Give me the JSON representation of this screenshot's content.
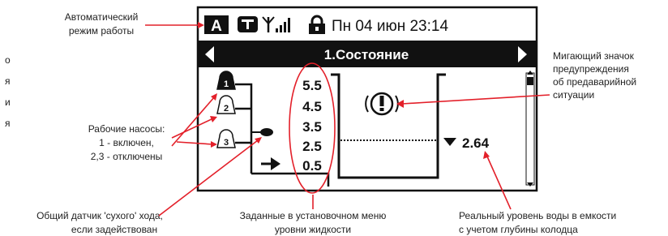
{
  "status_bar": {
    "mode_letter": "A",
    "date_time": "Пн 04 июн 23:14",
    "icons": [
      "pump-mode-icon",
      "antenna-signal-icon",
      "lock-icon"
    ]
  },
  "menu": {
    "title": "1.Состояние",
    "prev_icon": "triangle-left-icon",
    "next_icon": "triangle-right-icon"
  },
  "pumps": [
    {
      "number": "1",
      "state": "on"
    },
    {
      "number": "2",
      "state": "off"
    },
    {
      "number": "3",
      "state": "off"
    }
  ],
  "levels": [
    "5.5",
    "4.5",
    "3.5",
    "2.5",
    "0.5"
  ],
  "water_level": "2.64",
  "annotations": {
    "auto_mode_l1": "Автоматический",
    "auto_mode_l2": "режим работы",
    "warning_l1": "Мигающий значок",
    "warning_l2": "предупреждения",
    "warning_l3": "об предаварийной",
    "warning_l4": "ситуации",
    "pumps_l1": "Рабочие насосы:",
    "pumps_l2": "1 - включен,",
    "pumps_l3": "2,3 - отключены",
    "dry_run_l1": "Общий датчик 'сухого' хода,",
    "dry_run_l2": "если задействован",
    "set_levels_l1": "Заданные в установочном меню",
    "set_levels_l2": "уровни жидкости",
    "real_level_l1": "Реальный уровень воды в емкости",
    "real_level_l2": "с учетом глубины колодца"
  },
  "left_edge_fragments": [
    "о",
    "я",
    "и",
    "я"
  ],
  "colors": {
    "callout": "#e3202a",
    "lcd_ink": "#111111",
    "lcd_bg": "#ffffff"
  }
}
